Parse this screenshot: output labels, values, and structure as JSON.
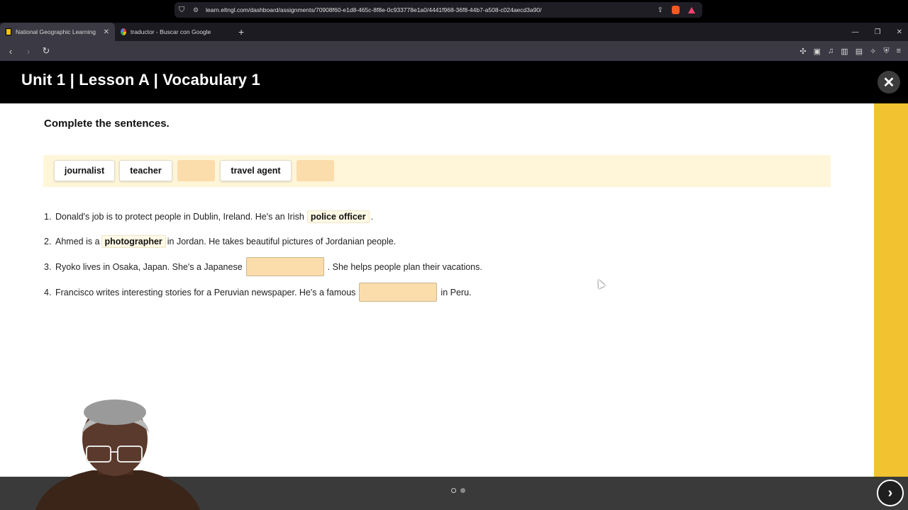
{
  "browser": {
    "tabs": [
      {
        "label": "National Geographic Learning",
        "active": true
      },
      {
        "label": "traductor - Buscar con Google",
        "active": false
      }
    ],
    "url": "learn.eltngl.com/dashboard/assignments/70908f60-e1d8-465c-8f8e-0c933778e1a0/4441f968-36f8-44b7-a508-c024aecd3a90/",
    "shield_count": "4"
  },
  "page": {
    "title": "Unit 1 | Lesson A | Vocabulary 1",
    "instruction": "Complete the sentences."
  },
  "word_bank": [
    {
      "label": "journalist",
      "used": false
    },
    {
      "label": "teacher",
      "used": false
    },
    {
      "label": "",
      "used": true
    },
    {
      "label": "travel agent",
      "used": false
    },
    {
      "label": "",
      "used": true
    }
  ],
  "sentences": [
    {
      "num": "1.",
      "before": "Donald's job is to protect people in Dublin, Ireland. He's an Irish",
      "answer": "police officer",
      "after": "."
    },
    {
      "num": "2.",
      "before": "Ahmed is a",
      "answer": "photographer",
      "after": "in Jordan. He takes beautiful pictures of Jordanian people."
    },
    {
      "num": "3.",
      "before": "Ryoko lives in Osaka, Japan. She's a Japanese",
      "answer": "",
      "after": ". She helps people plan their vacations."
    },
    {
      "num": "4.",
      "before": "Francisco writes interesting stories for a Peruvian newspaper. He's a famous",
      "answer": "",
      "after": "in Peru."
    }
  ],
  "pagination": {
    "current": 1,
    "total": 2
  },
  "colors": {
    "header_bg": "#000000",
    "accent_yellow": "#f2c230",
    "wordbank_bg": "#fff5d9",
    "blank_fill": "#fbdcab"
  },
  "icons": [
    "back-icon",
    "forward-icon",
    "reload-icon",
    "bookmark-icon",
    "close-icon",
    "next-arrow-icon"
  ]
}
